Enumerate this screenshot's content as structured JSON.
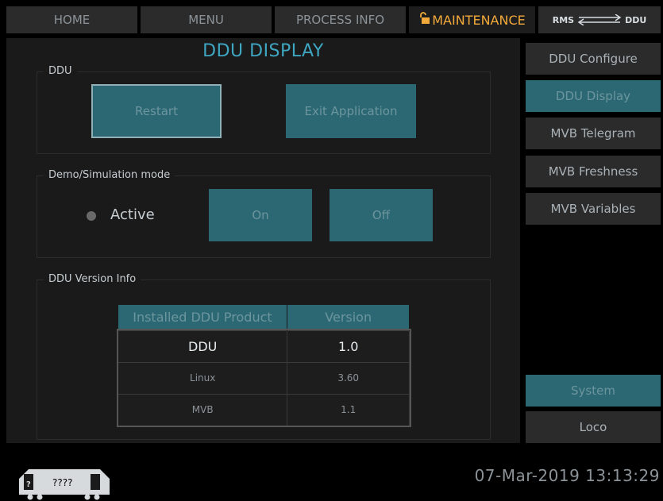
{
  "nav": {
    "home": "HOME",
    "menu": "MENU",
    "process_info": "PROCESS INFO",
    "maintenance": "MAINTENANCE",
    "rms": "RMS",
    "ddu": "DDU"
  },
  "page_title": "DDU DISPLAY",
  "ddu_group": {
    "label": "DDU",
    "restart": "Restart",
    "exit": "Exit Application"
  },
  "demo_group": {
    "label": "Demo/Simulation mode",
    "active_label": "Active",
    "on": "On",
    "off": "Off"
  },
  "version_group": {
    "label": "DDU Version Info",
    "headers": [
      "Installed DDU Product",
      "Version"
    ],
    "rows": [
      {
        "product": "DDU",
        "version": "1.0"
      },
      {
        "product": "Linux",
        "version": "3.60"
      },
      {
        "product": "MVB",
        "version": "1.1"
      }
    ]
  },
  "sidebar": {
    "items": [
      "DDU Configure",
      "DDU Display",
      "MVB Telegram",
      "MVB Freshness",
      "MVB Variables"
    ],
    "system": "System",
    "loco": "Loco"
  },
  "footer": {
    "loco_id": "????",
    "datetime": "07-Mar-2019 13:13:29"
  },
  "colors": {
    "accent": "#2c6874",
    "title": "#3fa6c2",
    "maintenance": "#f2a93b"
  }
}
